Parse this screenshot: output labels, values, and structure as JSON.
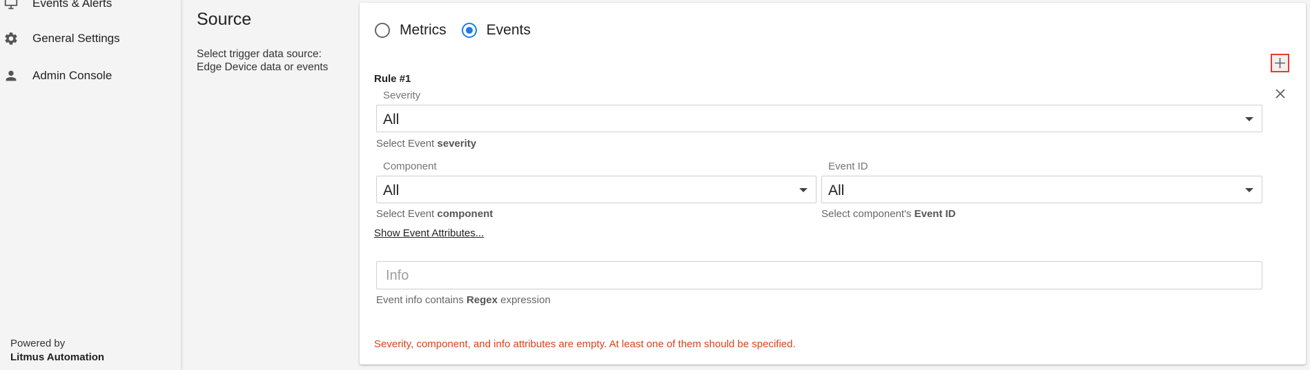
{
  "sidebar": {
    "items": [
      {
        "label": "Events & Alerts",
        "icon": "monitor-icon"
      },
      {
        "label": "General Settings",
        "icon": "gear-icon"
      },
      {
        "label": "Admin Console",
        "icon": "person-icon"
      }
    ],
    "powered_by": "Powered by",
    "brand": "Litmus Automation"
  },
  "section": {
    "title": "Source",
    "description": "Select trigger data source: Edge Device data or events"
  },
  "source_radio": {
    "options": [
      "Metrics",
      "Events"
    ],
    "selected": "Events"
  },
  "rule": {
    "title": "Rule #1",
    "severity": {
      "label": "Severity",
      "value": "All",
      "helper_prefix": "Select Event ",
      "helper_bold": "severity"
    },
    "component": {
      "label": "Component",
      "value": "All",
      "helper_prefix": "Select Event ",
      "helper_bold": "component"
    },
    "event_id": {
      "label": "Event ID",
      "value": "All",
      "helper_prefix": "Select component's ",
      "helper_bold": "Event ID"
    },
    "show_attributes": "Show Event Attributes...",
    "info": {
      "placeholder": "Info",
      "helper_prefix": "Event info contains ",
      "helper_bold": "Regex",
      "helper_suffix": " expression"
    },
    "error": "Severity, component, and info attributes are empty. At least one of them should be specified."
  },
  "colors": {
    "accent": "#1e7be6",
    "error": "#d84315",
    "highlight": "#e53935"
  }
}
